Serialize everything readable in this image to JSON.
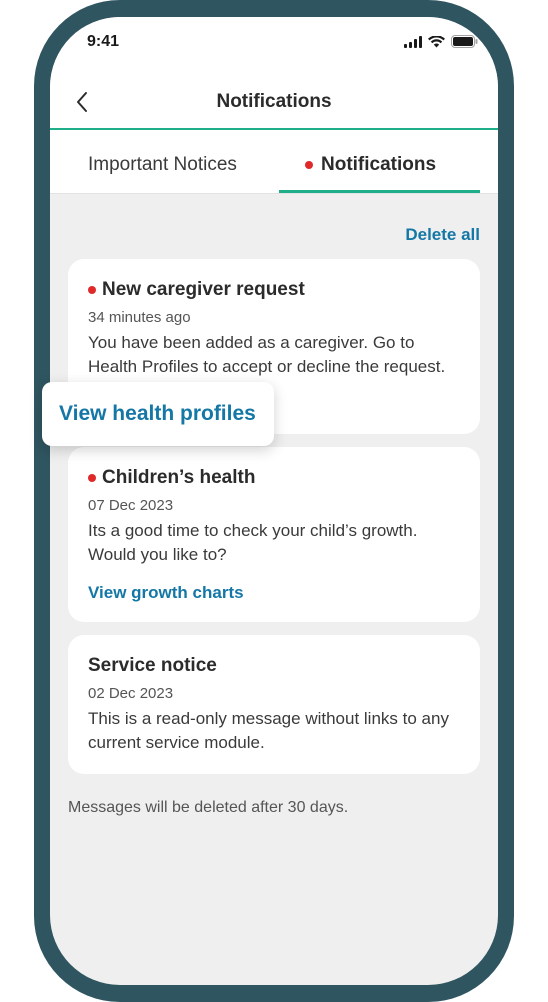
{
  "status_bar": {
    "time": "9:41"
  },
  "nav": {
    "title": "Notifications"
  },
  "tabs": [
    {
      "label": "Important Notices",
      "active": false
    },
    {
      "label": "Notifications",
      "active": true,
      "has_dot": true
    }
  ],
  "actions": {
    "delete_all": "Delete all"
  },
  "notifications": [
    {
      "title": "New caregiver request",
      "unread": true,
      "time": "34 minutes ago",
      "body": "You have been added as a caregiver. Go to Health Profiles to accept or decline the request.",
      "link": "View health profiles"
    },
    {
      "title": "Children’s health",
      "unread": true,
      "time": "07 Dec 2023",
      "body": "Its a good time to check your child’s growth. Would you like to?",
      "link": "View growth charts"
    },
    {
      "title": "Service notice",
      "unread": false,
      "time": "02 Dec 2023",
      "body": "This is a read-only message without links to any current service module."
    }
  ],
  "footer": {
    "note": "Messages will be deleted after 30 days."
  },
  "colors": {
    "accent": "#1fae8a",
    "link": "#1477a6",
    "unread_dot": "#e02a2a",
    "frame": "#2f5560"
  }
}
